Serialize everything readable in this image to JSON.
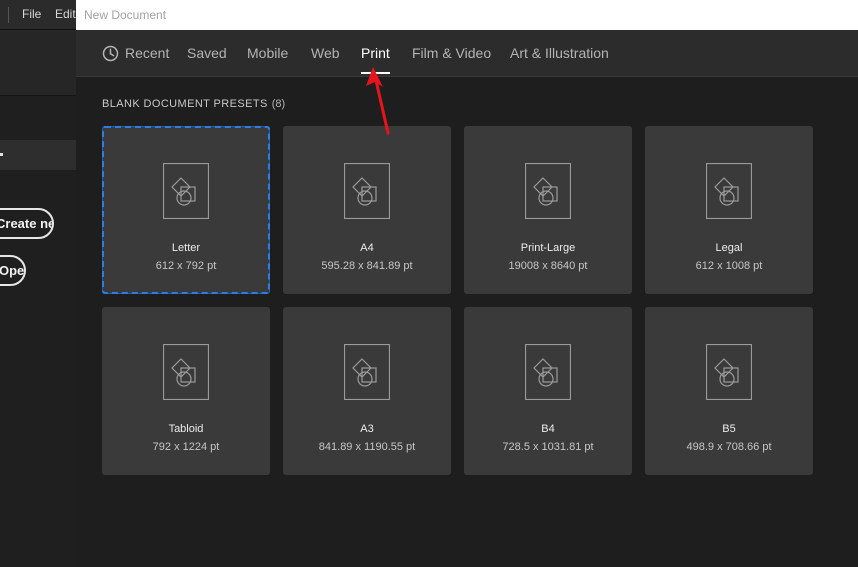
{
  "background_app": {
    "menu": [
      "File",
      "Edit"
    ],
    "create_new_label": "Create new",
    "open_label": "Open"
  },
  "dialog": {
    "title": "New Document",
    "tabs": [
      {
        "label": "Recent",
        "icon": "clock-icon"
      },
      {
        "label": "Saved"
      },
      {
        "label": "Mobile"
      },
      {
        "label": "Web"
      },
      {
        "label": "Print",
        "active": true
      },
      {
        "label": "Film & Video"
      },
      {
        "label": "Art & Illustration"
      }
    ],
    "section_heading": "BLANK DOCUMENT PRESETS",
    "section_count": "(8)",
    "presets": [
      {
        "name": "Letter",
        "dims": "612 x 792 pt",
        "selected": true
      },
      {
        "name": "A4",
        "dims": "595.28 x 841.89 pt"
      },
      {
        "name": "Print-Large",
        "dims": "19008 x 8640 pt"
      },
      {
        "name": "Legal",
        "dims": "612 x 1008 pt"
      },
      {
        "name": "Tabloid",
        "dims": "792 x 1224 pt"
      },
      {
        "name": "A3",
        "dims": "841.89 x 1190.55 pt"
      },
      {
        "name": "B4",
        "dims": "728.5 x 1031.81 pt"
      },
      {
        "name": "B5",
        "dims": "498.9 x 708.66 pt"
      }
    ]
  },
  "colors": {
    "selection_outline": "#2f7de1",
    "annotation_arrow": "#e8141b",
    "card_bg": "#3a3a3a"
  }
}
